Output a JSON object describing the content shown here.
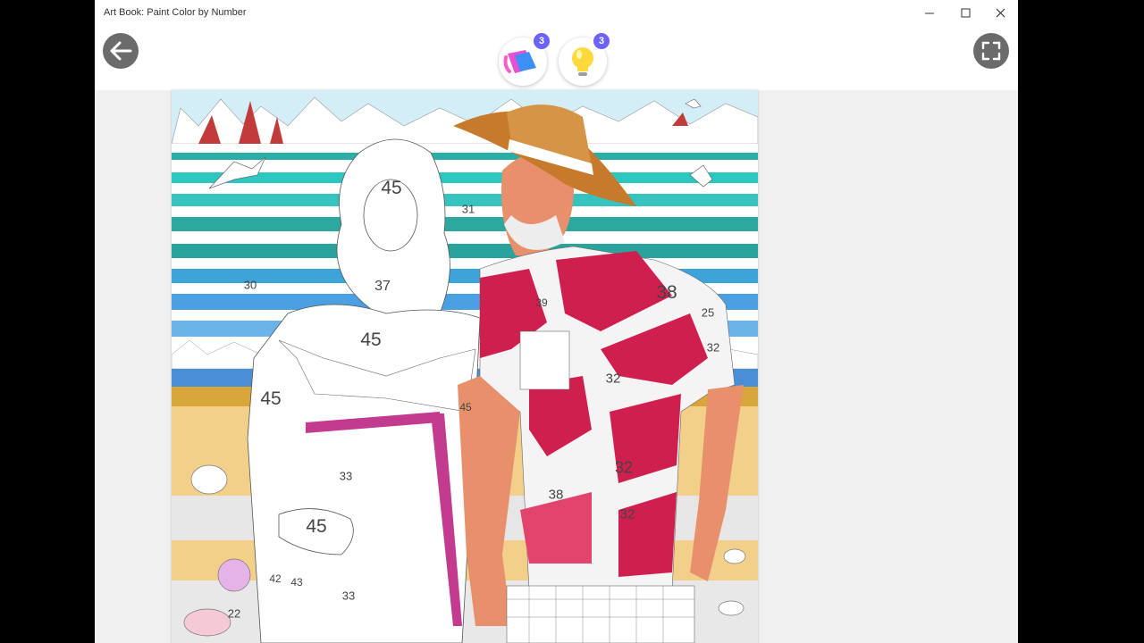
{
  "window": {
    "title": "Art Book: Paint Color by Number"
  },
  "tools": {
    "fill_count": "3",
    "hint_count": "3"
  },
  "numbers": [
    {
      "label": "45",
      "size": "big"
    },
    {
      "label": "31",
      "size": "small"
    },
    {
      "label": "30",
      "size": "small"
    },
    {
      "label": "37",
      "size": "mid"
    },
    {
      "label": "38",
      "size": "big"
    },
    {
      "label": "25",
      "size": "small"
    },
    {
      "label": "39",
      "size": "small"
    },
    {
      "label": "45",
      "size": "big"
    },
    {
      "label": "32",
      "size": "small"
    },
    {
      "label": "45",
      "size": "big"
    },
    {
      "label": "45",
      "size": "small"
    },
    {
      "label": "32",
      "size": "mid"
    },
    {
      "label": "33",
      "size": "small"
    },
    {
      "label": "32",
      "size": "mid"
    },
    {
      "label": "38",
      "size": "mid"
    },
    {
      "label": "32",
      "size": "mid"
    },
    {
      "label": "45",
      "size": "big"
    },
    {
      "label": "42",
      "size": "small"
    },
    {
      "label": "43",
      "size": "small"
    },
    {
      "label": "33",
      "size": "small"
    },
    {
      "label": "22",
      "size": "small"
    }
  ],
  "colors": {
    "accent": "#6c63ff",
    "shirt_red": "#cf1f4f",
    "sky": "#d3eef7",
    "teal": "#2cc7c0",
    "ocean_blue": "#4aa0e0",
    "sand": "#f2d08a",
    "skin": "#e8906b",
    "hat": "#c77a2c"
  }
}
